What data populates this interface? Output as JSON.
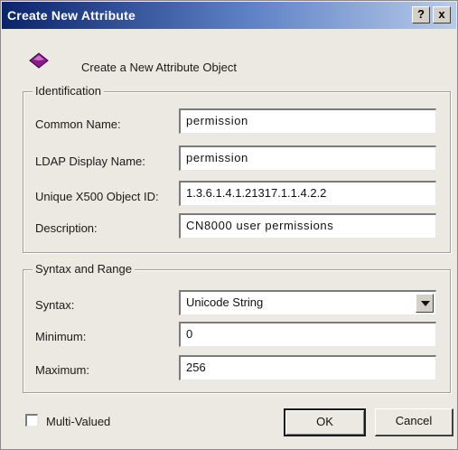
{
  "window": {
    "title": "Create New Attribute",
    "help_label": "?",
    "close_label": "x"
  },
  "header": {
    "icon": "attribute-object-icon",
    "text": "Create a New Attribute Object"
  },
  "identification": {
    "group_label": "Identification",
    "common_name_label": "Common Name:",
    "common_name_value": "permission",
    "ldap_display_name_label": "LDAP Display Name:",
    "ldap_display_name_value": "permission",
    "unique_x500_oid_label": "Unique X500 Object ID:",
    "unique_x500_oid_value": "1.3.6.1.4.1.21317.1.1.4.2.2",
    "description_label": "Description:",
    "description_value": "CN8000 user permissions"
  },
  "syntax_range": {
    "group_label": "Syntax and Range",
    "syntax_label": "Syntax:",
    "syntax_value": "Unicode String",
    "minimum_label": "Minimum:",
    "minimum_value": "0",
    "maximum_label": "Maximum:",
    "maximum_value": "256"
  },
  "footer": {
    "multi_valued_label": "Multi-Valued",
    "multi_valued_checked": false,
    "ok_label": "OK",
    "cancel_label": "Cancel"
  },
  "colors": {
    "title_start": "#0a246a",
    "title_end": "#b7cbe9",
    "face": "#ece9e2",
    "icon": "#8b1a8b"
  }
}
